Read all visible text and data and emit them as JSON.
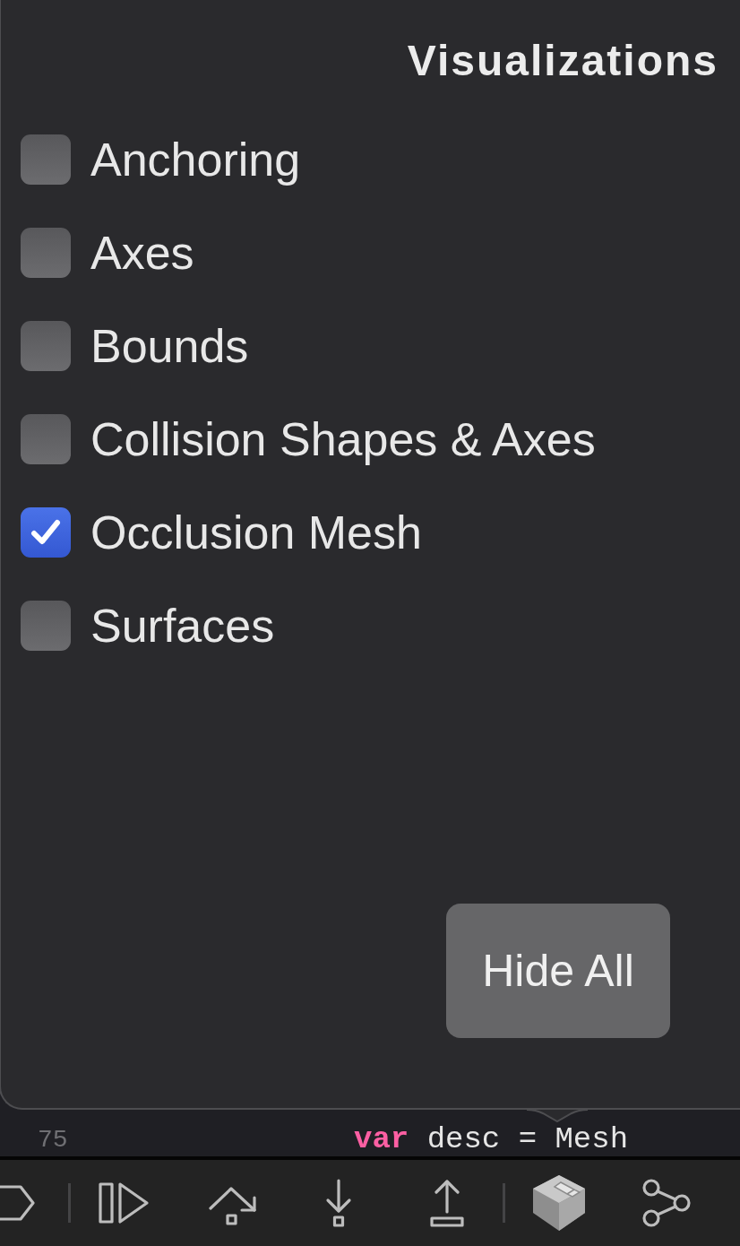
{
  "popover": {
    "title": "Visualizations",
    "options": [
      {
        "label": "Anchoring",
        "checked": false
      },
      {
        "label": "Axes",
        "checked": false
      },
      {
        "label": "Bounds",
        "checked": false
      },
      {
        "label": "Collision Shapes & Axes",
        "checked": false
      },
      {
        "label": "Occlusion Mesh",
        "checked": true
      },
      {
        "label": "Surfaces",
        "checked": false
      }
    ],
    "button": "Hide All"
  },
  "editor": {
    "line_number": "75",
    "code": [
      {
        "kind": "keyword",
        "text": "var"
      },
      {
        "kind": "plain",
        "text": "desc = Mesh"
      }
    ]
  },
  "toolbar": {
    "buttons": [
      {
        "selected": false
      },
      {
        "selected": false
      },
      {
        "selected": false
      },
      {
        "selected": false
      },
      {
        "selected": false
      },
      {
        "selected": true
      },
      {
        "selected": false
      }
    ]
  }
}
